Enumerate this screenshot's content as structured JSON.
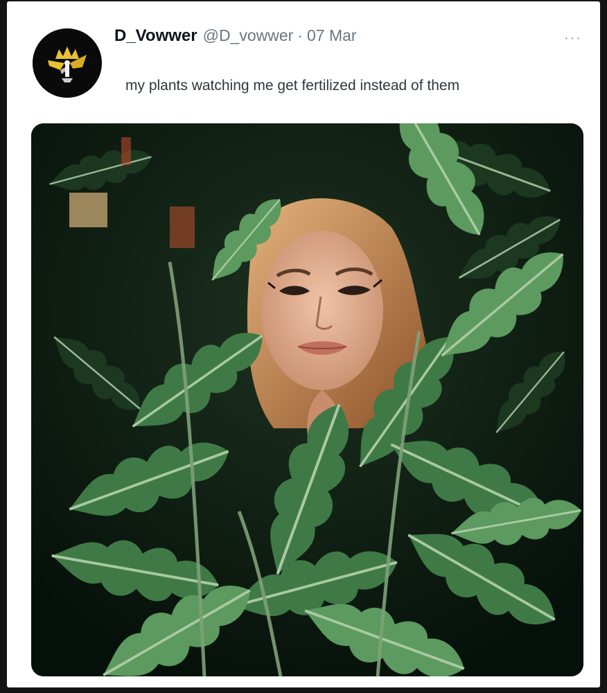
{
  "tweet": {
    "display_name": "D_Vowwer",
    "handle": "@D_vowwer",
    "separator": "·",
    "date": "07 Mar",
    "more_label": "···",
    "text": "my plants watching me get fertilized instead of them"
  },
  "avatar": {
    "icon": "gold-crown-figure-logo",
    "background": "#0a0a0a",
    "accent": "#e8c233"
  },
  "media": {
    "kind": "photo",
    "description": "woman peering through green oak-leaf foliage at night"
  },
  "colors": {
    "card_background": "#ffffff",
    "page_background": "#141414",
    "name_color": "#0f1419",
    "secondary_text": "#6b7680"
  }
}
